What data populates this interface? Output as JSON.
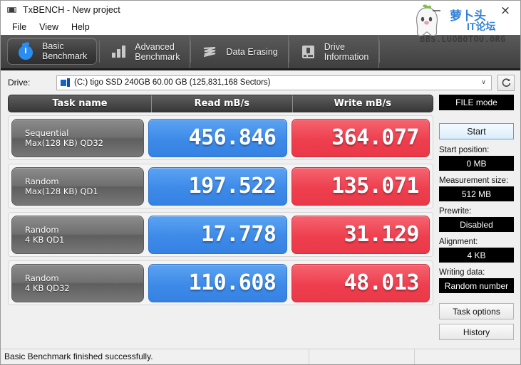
{
  "window": {
    "title": "TxBENCH - New project",
    "app_icon": "drive-icon",
    "close_label": "×"
  },
  "menu": {
    "items": [
      {
        "label": "File"
      },
      {
        "label": "View"
      },
      {
        "label": "Help"
      }
    ]
  },
  "watermark": {
    "cn_line1": "萝卜头",
    "cn_line2": "IT论坛",
    "url": "BBS.LUOBOTOU.ORG"
  },
  "tabs": [
    {
      "label": "Basic\nBenchmark",
      "icon": "stopwatch-icon",
      "active": true
    },
    {
      "label": "Advanced\nBenchmark",
      "icon": "bar-chart-icon",
      "active": false
    },
    {
      "label": "Data Erasing",
      "icon": "erase-waves-icon",
      "active": false
    },
    {
      "label": "Drive\nInformation",
      "icon": "hard-drive-icon",
      "active": false
    }
  ],
  "drive": {
    "label": "Drive:",
    "selected": "(C:) tigo SSD 240GB  60.00 GB (125,831,168 Sectors)",
    "caret": "∨",
    "disk_icon": "disk-icon",
    "refresh_icon": "refresh-icon"
  },
  "results": {
    "headers": [
      "Task name",
      "Read mB/s",
      "Write mB/s"
    ],
    "rows": [
      {
        "name_line1": "Sequential",
        "name_line2": "Max(128 KB) QD32",
        "read": "456.846",
        "write": "364.077"
      },
      {
        "name_line1": "Random",
        "name_line2": "Max(128 KB) QD1",
        "read": "197.522",
        "write": "135.071"
      },
      {
        "name_line1": "Random",
        "name_line2": "4 KB QD1",
        "read": "17.778",
        "write": "31.129"
      },
      {
        "name_line1": "Random",
        "name_line2": "4 KB QD32",
        "read": "110.608",
        "write": "48.013"
      }
    ]
  },
  "panel": {
    "mode_button": "FILE mode",
    "start_button": "Start",
    "start_position_label": "Start position:",
    "start_position_value": "0 MB",
    "measurement_size_label": "Measurement size:",
    "measurement_size_value": "512 MB",
    "prewrite_label": "Prewrite:",
    "prewrite_value": "Disabled",
    "alignment_label": "Alignment:",
    "alignment_value": "4 KB",
    "writing_data_label": "Writing data:",
    "writing_data_value": "Random number",
    "task_options_button": "Task options",
    "history_button": "History"
  },
  "status": {
    "message": "Basic Benchmark finished successfully.",
    "segment2": "",
    "segment3": ""
  },
  "colors": {
    "read_accent": "#3d8ae8",
    "write_accent": "#ee3f4f",
    "tab_bar": "#4e4e4e",
    "value_field_bg": "#000000",
    "watermark_blue": "#2f7fd6"
  }
}
